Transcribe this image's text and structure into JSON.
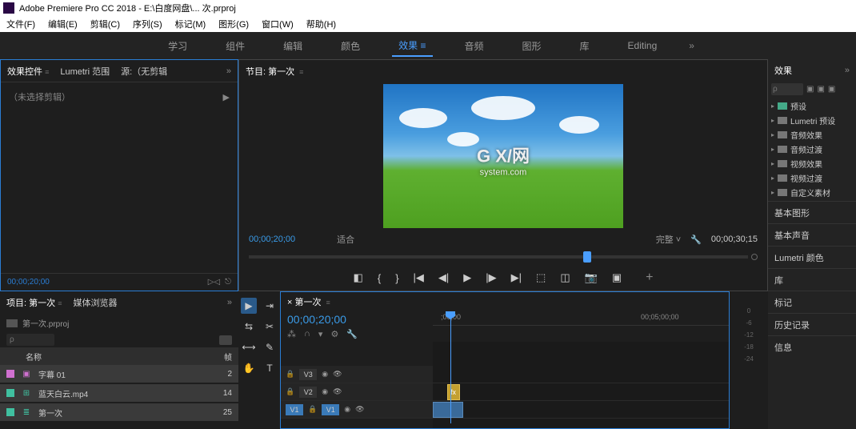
{
  "title": "Adobe Premiere Pro CC 2018 - E:\\白度网盘\\... 次.prproj",
  "menu": [
    "文件(F)",
    "编辑(E)",
    "剪辑(C)",
    "序列(S)",
    "标记(M)",
    "图形(G)",
    "窗口(W)",
    "帮助(H)"
  ],
  "workspaces": {
    "items": [
      "学习",
      "组件",
      "编辑",
      "颜色",
      "效果",
      "音频",
      "图形",
      "库",
      "Editing"
    ],
    "active_index": 4,
    "more": "»"
  },
  "effect_controls": {
    "tabs": [
      "效果控件",
      "Lumetri 范围",
      "源:（无剪辑"
    ],
    "active_tab": 0,
    "body_text": "（未选择剪辑）",
    "footer_time": "00;00;20;00"
  },
  "project": {
    "tabs": [
      "项目: 第一次",
      "媒体浏览器"
    ],
    "active_tab": 0,
    "more": "»",
    "path": "第一次.prproj",
    "search_placeholder": "ρ",
    "header_name": "名称",
    "header_fr": "帧",
    "items": [
      {
        "color": "#d070d0",
        "icon": "text",
        "label": "字幕 01",
        "fr": "2"
      },
      {
        "color": "#40c0a0",
        "icon": "video",
        "label": "蓝天白云.mp4",
        "fr": "14"
      },
      {
        "color": "#40c0a0",
        "icon": "seq",
        "label": "第一次",
        "fr": "25"
      }
    ]
  },
  "program": {
    "title": "节目: 第一次",
    "watermark_main": "G X/网",
    "watermark_sub": "system.com",
    "time_left": "00;00;20;00",
    "fit": "适合",
    "zoom": "完整",
    "time_right": "00;00;30;15"
  },
  "timeline": {
    "title": "第一次",
    "time": "00;00;20;00",
    "ruler": [
      ";00;00",
      "00;05;00;00"
    ],
    "tracks": [
      {
        "label": "V3",
        "active": false
      },
      {
        "label": "V2",
        "active": false
      },
      {
        "label": "V1",
        "active": true
      }
    ],
    "clip1_label": "fx",
    "audio_marks": [
      "0",
      "-6",
      "-12",
      "-18",
      "-24"
    ]
  },
  "effects": {
    "title": "效果",
    "items": [
      {
        "type": "preset",
        "label": "预设"
      },
      {
        "type": "folder",
        "label": "Lumetri 预设"
      },
      {
        "type": "folder",
        "label": "音频效果"
      },
      {
        "type": "folder",
        "label": "音频过渡"
      },
      {
        "type": "folder",
        "label": "视频效果"
      },
      {
        "type": "folder",
        "label": "视频过渡"
      },
      {
        "type": "folder",
        "label": "自定义素材"
      }
    ]
  },
  "side_panels": [
    "基本图形",
    "基本声音",
    "Lumetri 颜色",
    "库",
    "标记",
    "历史记录",
    "信息"
  ]
}
